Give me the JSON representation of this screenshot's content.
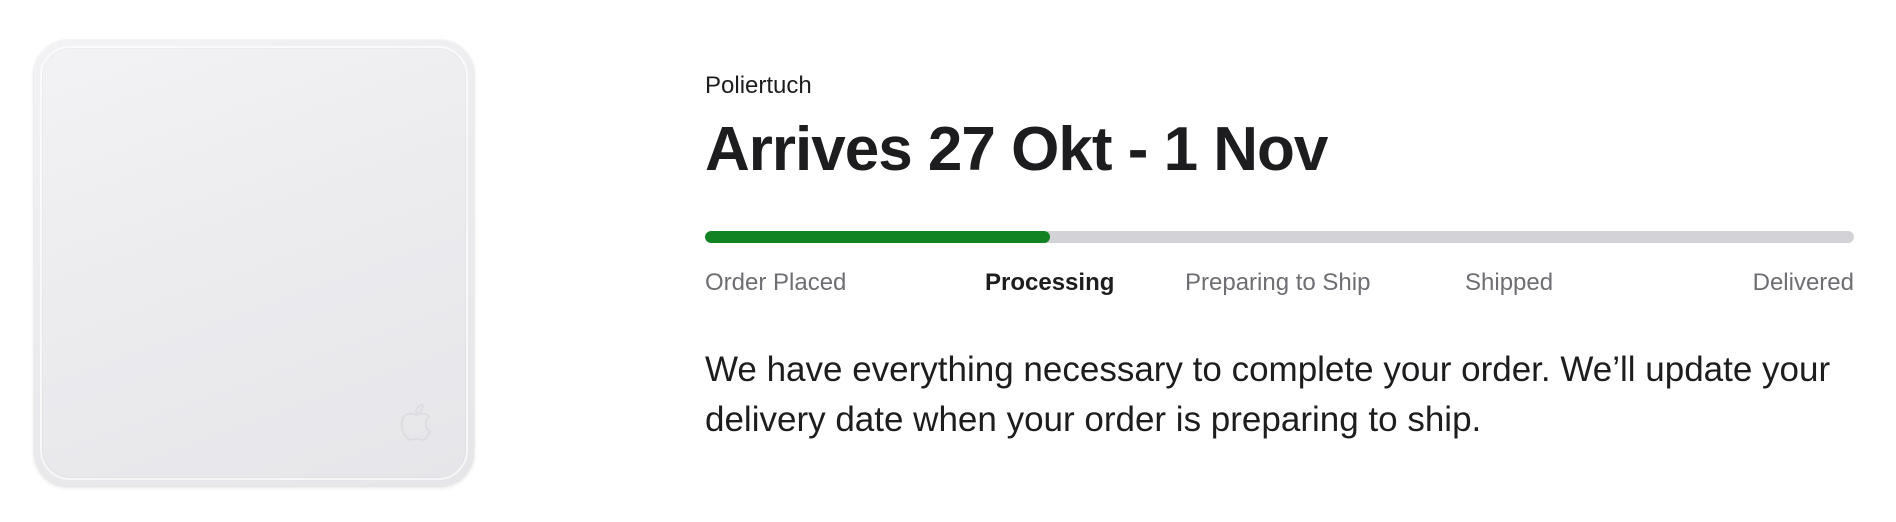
{
  "product": {
    "image_icon": "polishing-cloth-image",
    "name": "Poliertuch"
  },
  "delivery": {
    "headline": "Arrives 27 Okt - 1 Nov"
  },
  "progress": {
    "fill_fraction": 0.3,
    "fill_color": "#128323",
    "track_color": "#d2d2d7",
    "current_step_index": 1,
    "steps": [
      {
        "label": "Order Placed"
      },
      {
        "label": "Processing"
      },
      {
        "label": "Preparing to Ship"
      },
      {
        "label": "Shipped"
      },
      {
        "label": "Delivered"
      }
    ]
  },
  "status_message": "We have everything necessary to complete your order. We’ll update your delivery date when your order is preparing to ship."
}
